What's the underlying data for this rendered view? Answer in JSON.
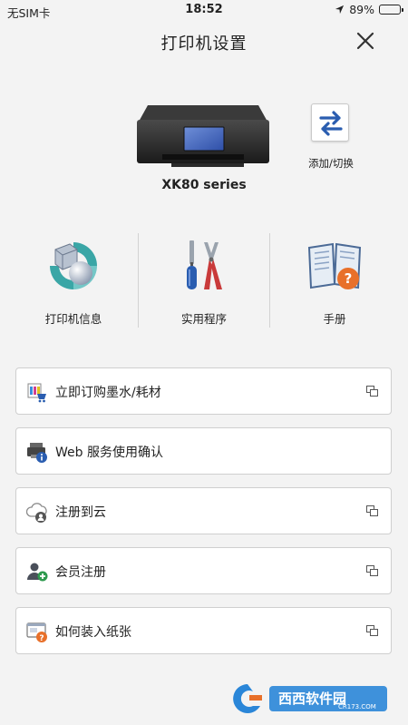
{
  "status_bar": {
    "carrier": "无SIM卡",
    "time": "18:52",
    "battery": "89%",
    "battery_level": 0.89
  },
  "header": {
    "title": "打印机设置"
  },
  "printer": {
    "name": "XK80 series",
    "switch_label": "添加/切换"
  },
  "tools": [
    {
      "label": "打印机信息",
      "icon": "printer-info-icon"
    },
    {
      "label": "实用程序",
      "icon": "utility-tools-icon"
    },
    {
      "label": "手册",
      "icon": "manual-icon"
    }
  ],
  "menu": [
    {
      "label": "立即订购墨水/耗材",
      "icon": "ink-order-icon",
      "external": true
    },
    {
      "label": "Web 服务使用确认",
      "icon": "web-service-icon",
      "external": false
    },
    {
      "label": "注册到云",
      "icon": "cloud-register-icon",
      "external": true
    },
    {
      "label": "会员注册",
      "icon": "member-register-icon",
      "external": true
    },
    {
      "label": "如何装入纸张",
      "icon": "load-paper-icon",
      "external": true
    }
  ],
  "watermark": {
    "text": "西西软件园",
    "subtext": "CR173.COM"
  },
  "colors": {
    "accent_blue": "#2a5db0",
    "orange": "#e8702a",
    "background": "#f3f3f3"
  }
}
